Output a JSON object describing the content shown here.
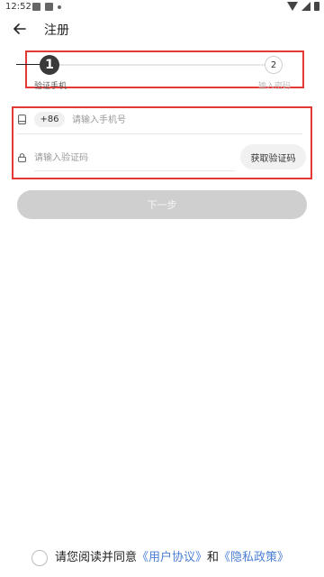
{
  "status_bar": {
    "time": "12:52",
    "icons": [
      "notification-icon",
      "image-icon",
      "dot-icon",
      "wifi-icon",
      "signal-icon",
      "battery-icon"
    ]
  },
  "app_bar": {
    "title": "注册",
    "back_icon": "arrow-left-icon"
  },
  "stepper": {
    "steps": [
      {
        "number": "1",
        "label": "验证手机",
        "state": "active"
      },
      {
        "number": "2",
        "label": "输入密码",
        "state": "inactive"
      }
    ]
  },
  "form": {
    "country_code": "+86",
    "phone_placeholder": "请输入手机号",
    "phone_value": "",
    "code_placeholder": "请输入验证码",
    "code_value": "",
    "get_code_label": "获取验证码"
  },
  "next_button": {
    "label": "下一步",
    "enabled": false
  },
  "agreement": {
    "prefix": "请您阅读并同意",
    "user_agreement": "《用户协议》",
    "conjunction": "和",
    "privacy_policy": "《隐私政策》",
    "checked": false
  },
  "colors": {
    "highlight_border": "#e53935",
    "link": "#4a7fd4",
    "button_disabled": "#cfcfcf",
    "step_active": "#3a3a3a"
  }
}
